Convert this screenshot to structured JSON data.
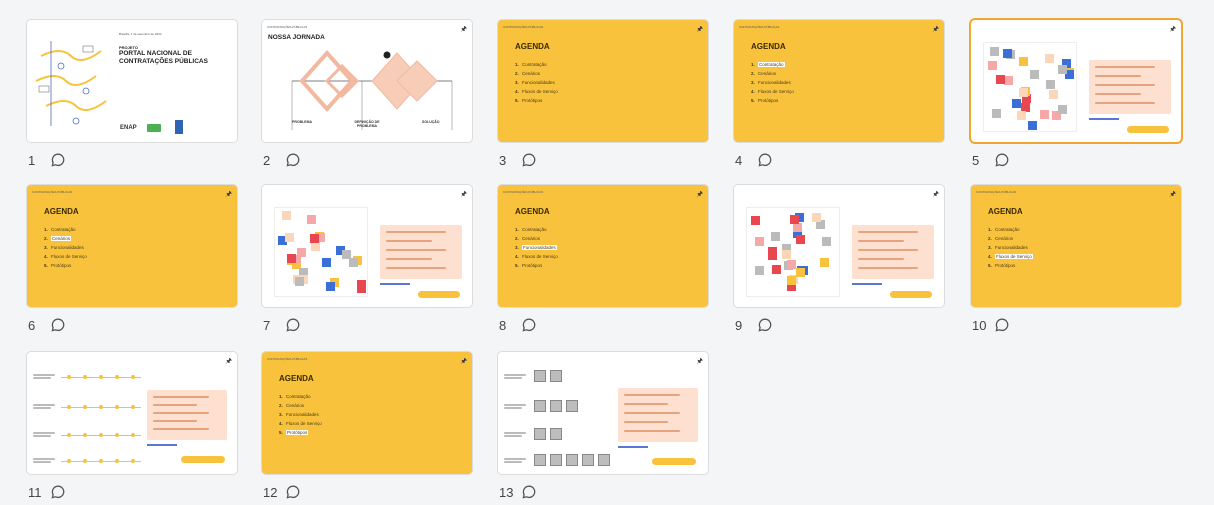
{
  "slides": [
    {
      "number": "1",
      "type": "cover",
      "date": "Brasília, 1 de setembro de 2024",
      "kicker": "PROJETO",
      "title_line1": "PORTAL NACIONAL DE",
      "title_line2": "CONTRATAÇÕES PÚBLICAS",
      "logo_text": "ENAP"
    },
    {
      "number": "2",
      "type": "journey",
      "header": "CONTRATAÇÕES PÚBLICAS",
      "title": "NOSSA JORNADA",
      "footer_left": "PROBLEMA",
      "footer_mid": "DEFINIÇÃO DE PROBLEMA",
      "footer_right": "SOLUÇÃO"
    },
    {
      "number": "3",
      "type": "agenda",
      "highlight": -1
    },
    {
      "number": "4",
      "type": "agenda",
      "highlight": 0
    },
    {
      "number": "5",
      "type": "board",
      "selected": true
    },
    {
      "number": "6",
      "type": "agenda",
      "highlight": 1
    },
    {
      "number": "7",
      "type": "board"
    },
    {
      "number": "8",
      "type": "agenda",
      "highlight": 2
    },
    {
      "number": "9",
      "type": "board"
    },
    {
      "number": "10",
      "type": "agenda",
      "highlight": 3
    },
    {
      "number": "11",
      "type": "dots"
    },
    {
      "number": "12",
      "type": "agenda",
      "highlight": 4
    },
    {
      "number": "13",
      "type": "qr"
    }
  ],
  "agenda": {
    "header": "CONTRATAÇÕES PÚBLICAS",
    "title": "AGENDA",
    "items": [
      "Contratação",
      "Cenários",
      "Funcionalidades",
      "Fluxos de Serviço",
      "Protótipos"
    ]
  },
  "colors": {
    "accent_yellow": "#f8c23d",
    "panel_peach": "#fde0cf",
    "selection": "#f0a630"
  }
}
